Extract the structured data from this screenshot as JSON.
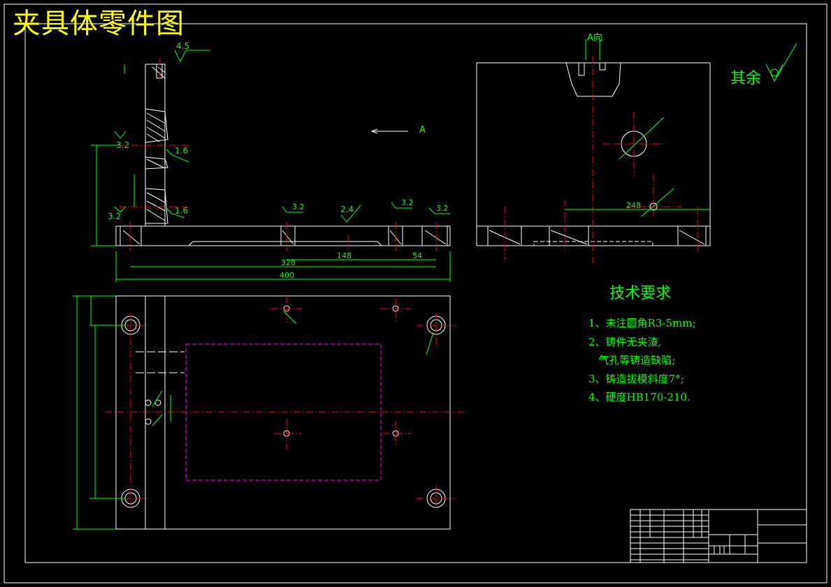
{
  "drawing": {
    "title": "夹具体零件图",
    "view_label": "A向",
    "arrow_label": "A",
    "rest_roughness_label": "其余",
    "roughness_values": [
      "4.5",
      "3.2",
      "1.6",
      "3.2",
      "1.6",
      "2.4",
      "3.2",
      "3.2",
      "3.2"
    ],
    "dimension_values": [
      "400",
      "328",
      "248",
      "148",
      "54"
    ]
  },
  "technical_requirements": {
    "title": "技术要求",
    "items": [
      "1、未注圆角R3-5mm;",
      "2、铸件无夹渣,",
      "   气孔等铸造缺陷;",
      "3、铸造拔模斜度7°;",
      "4、硬度HB170-210."
    ]
  },
  "colors": {
    "background": "#000000",
    "outline": "#ffffff",
    "centerline": "#ff0000",
    "dimension": "#00ff00",
    "hidden": "#ff00ff",
    "title": "#ffff00"
  }
}
